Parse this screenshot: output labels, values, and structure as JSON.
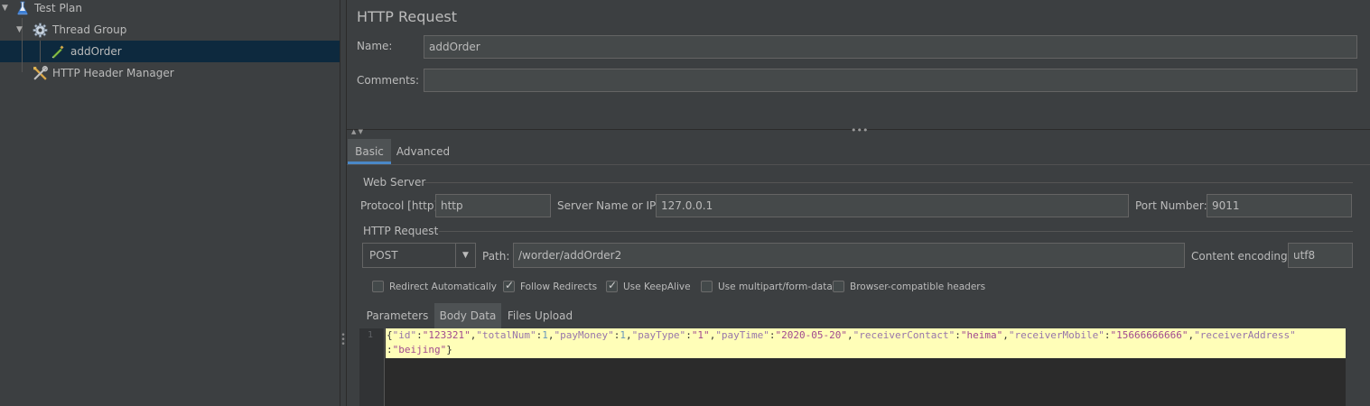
{
  "tree": {
    "items": [
      {
        "label": "Test Plan",
        "icon": "flask-icon"
      },
      {
        "label": "Thread Group",
        "icon": "gear-icon"
      },
      {
        "label": "addOrder",
        "icon": "pipette-icon",
        "selected": true
      },
      {
        "label": "HTTP Header Manager",
        "icon": "wrench-icon"
      }
    ]
  },
  "form": {
    "title": "HTTP Request",
    "name_label": "Name:",
    "name_value": "addOrder",
    "comments_label": "Comments:",
    "comments_value": ""
  },
  "tabs": [
    {
      "label": "Basic",
      "active": true
    },
    {
      "label": "Advanced",
      "active": false
    }
  ],
  "web_server": {
    "section_label": "Web Server",
    "protocol_label": "Protocol [http]:",
    "protocol_value": "http",
    "server_label": "Server Name or IP:",
    "server_value": "127.0.0.1",
    "port_label": "Port Number:",
    "port_value": "9011"
  },
  "http_request": {
    "section_label": "HTTP Request",
    "method_value": "POST",
    "path_label": "Path:",
    "path_value": "/worder/addOrder2",
    "encoding_label": "Content encoding:",
    "encoding_value": "utf8"
  },
  "checkboxes": [
    {
      "label": "Redirect Automatically",
      "checked": false
    },
    {
      "label": "Follow Redirects",
      "checked": true
    },
    {
      "label": "Use KeepAlive",
      "checked": true
    },
    {
      "label": "Use multipart/form-data",
      "checked": false
    },
    {
      "label": "Browser-compatible headers",
      "checked": false
    }
  ],
  "sub_tabs": [
    {
      "label": "Parameters",
      "active": false
    },
    {
      "label": "Body Data",
      "active": true
    },
    {
      "label": "Files Upload",
      "active": false
    }
  ],
  "body": {
    "line_number": "1",
    "line1_parts": [
      {
        "t": "{",
        "c": "p"
      },
      {
        "t": "\"id\"",
        "c": "k"
      },
      {
        "t": ":",
        "c": "p"
      },
      {
        "t": "\"123321\"",
        "c": "s"
      },
      {
        "t": ",",
        "c": "p"
      },
      {
        "t": "\"totalNum\"",
        "c": "k"
      },
      {
        "t": ":",
        "c": "p"
      },
      {
        "t": "1",
        "c": "n"
      },
      {
        "t": ",",
        "c": "p"
      },
      {
        "t": "\"payMoney\"",
        "c": "k"
      },
      {
        "t": ":",
        "c": "p"
      },
      {
        "t": "1",
        "c": "n"
      },
      {
        "t": ",",
        "c": "p"
      },
      {
        "t": "\"payType\"",
        "c": "k"
      },
      {
        "t": ":",
        "c": "p"
      },
      {
        "t": "\"1\"",
        "c": "s"
      },
      {
        "t": ",",
        "c": "p"
      },
      {
        "t": "\"payTime\"",
        "c": "k"
      },
      {
        "t": ":",
        "c": "p"
      },
      {
        "t": "\"2020-05-20\"",
        "c": "s"
      },
      {
        "t": ",",
        "c": "p"
      },
      {
        "t": "\"receiverContact\"",
        "c": "k"
      },
      {
        "t": ":",
        "c": "p"
      },
      {
        "t": "\"heima\"",
        "c": "s"
      },
      {
        "t": ",",
        "c": "p"
      },
      {
        "t": "\"receiverMobile\"",
        "c": "k"
      },
      {
        "t": ":",
        "c": "p"
      },
      {
        "t": "\"15666666666\"",
        "c": "s"
      },
      {
        "t": ",",
        "c": "p"
      },
      {
        "t": "\"receiverAddress\"",
        "c": "k"
      }
    ],
    "line2_parts": [
      {
        "t": ":",
        "c": "p"
      },
      {
        "t": "\"beijing\"",
        "c": "s"
      },
      {
        "t": "}",
        "c": "p"
      }
    ]
  },
  "colors": {
    "background": "#3c3f41",
    "selection": "#0d293e",
    "accent": "#4a88c7",
    "editor_highlight": "#fffeb8"
  }
}
